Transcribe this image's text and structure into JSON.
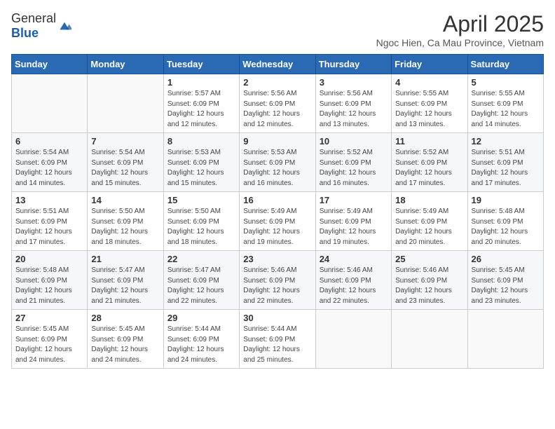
{
  "header": {
    "logo_general": "General",
    "logo_blue": "Blue",
    "month_title": "April 2025",
    "location": "Ngoc Hien, Ca Mau Province, Vietnam"
  },
  "weekdays": [
    "Sunday",
    "Monday",
    "Tuesday",
    "Wednesday",
    "Thursday",
    "Friday",
    "Saturday"
  ],
  "weeks": [
    [
      {
        "day": "",
        "info": ""
      },
      {
        "day": "",
        "info": ""
      },
      {
        "day": "1",
        "info": "Sunrise: 5:57 AM\nSunset: 6:09 PM\nDaylight: 12 hours and 12 minutes."
      },
      {
        "day": "2",
        "info": "Sunrise: 5:56 AM\nSunset: 6:09 PM\nDaylight: 12 hours and 12 minutes."
      },
      {
        "day": "3",
        "info": "Sunrise: 5:56 AM\nSunset: 6:09 PM\nDaylight: 12 hours and 13 minutes."
      },
      {
        "day": "4",
        "info": "Sunrise: 5:55 AM\nSunset: 6:09 PM\nDaylight: 12 hours and 13 minutes."
      },
      {
        "day": "5",
        "info": "Sunrise: 5:55 AM\nSunset: 6:09 PM\nDaylight: 12 hours and 14 minutes."
      }
    ],
    [
      {
        "day": "6",
        "info": "Sunrise: 5:54 AM\nSunset: 6:09 PM\nDaylight: 12 hours and 14 minutes."
      },
      {
        "day": "7",
        "info": "Sunrise: 5:54 AM\nSunset: 6:09 PM\nDaylight: 12 hours and 15 minutes."
      },
      {
        "day": "8",
        "info": "Sunrise: 5:53 AM\nSunset: 6:09 PM\nDaylight: 12 hours and 15 minutes."
      },
      {
        "day": "9",
        "info": "Sunrise: 5:53 AM\nSunset: 6:09 PM\nDaylight: 12 hours and 16 minutes."
      },
      {
        "day": "10",
        "info": "Sunrise: 5:52 AM\nSunset: 6:09 PM\nDaylight: 12 hours and 16 minutes."
      },
      {
        "day": "11",
        "info": "Sunrise: 5:52 AM\nSunset: 6:09 PM\nDaylight: 12 hours and 17 minutes."
      },
      {
        "day": "12",
        "info": "Sunrise: 5:51 AM\nSunset: 6:09 PM\nDaylight: 12 hours and 17 minutes."
      }
    ],
    [
      {
        "day": "13",
        "info": "Sunrise: 5:51 AM\nSunset: 6:09 PM\nDaylight: 12 hours and 17 minutes."
      },
      {
        "day": "14",
        "info": "Sunrise: 5:50 AM\nSunset: 6:09 PM\nDaylight: 12 hours and 18 minutes."
      },
      {
        "day": "15",
        "info": "Sunrise: 5:50 AM\nSunset: 6:09 PM\nDaylight: 12 hours and 18 minutes."
      },
      {
        "day": "16",
        "info": "Sunrise: 5:49 AM\nSunset: 6:09 PM\nDaylight: 12 hours and 19 minutes."
      },
      {
        "day": "17",
        "info": "Sunrise: 5:49 AM\nSunset: 6:09 PM\nDaylight: 12 hours and 19 minutes."
      },
      {
        "day": "18",
        "info": "Sunrise: 5:49 AM\nSunset: 6:09 PM\nDaylight: 12 hours and 20 minutes."
      },
      {
        "day": "19",
        "info": "Sunrise: 5:48 AM\nSunset: 6:09 PM\nDaylight: 12 hours and 20 minutes."
      }
    ],
    [
      {
        "day": "20",
        "info": "Sunrise: 5:48 AM\nSunset: 6:09 PM\nDaylight: 12 hours and 21 minutes."
      },
      {
        "day": "21",
        "info": "Sunrise: 5:47 AM\nSunset: 6:09 PM\nDaylight: 12 hours and 21 minutes."
      },
      {
        "day": "22",
        "info": "Sunrise: 5:47 AM\nSunset: 6:09 PM\nDaylight: 12 hours and 22 minutes."
      },
      {
        "day": "23",
        "info": "Sunrise: 5:46 AM\nSunset: 6:09 PM\nDaylight: 12 hours and 22 minutes."
      },
      {
        "day": "24",
        "info": "Sunrise: 5:46 AM\nSunset: 6:09 PM\nDaylight: 12 hours and 22 minutes."
      },
      {
        "day": "25",
        "info": "Sunrise: 5:46 AM\nSunset: 6:09 PM\nDaylight: 12 hours and 23 minutes."
      },
      {
        "day": "26",
        "info": "Sunrise: 5:45 AM\nSunset: 6:09 PM\nDaylight: 12 hours and 23 minutes."
      }
    ],
    [
      {
        "day": "27",
        "info": "Sunrise: 5:45 AM\nSunset: 6:09 PM\nDaylight: 12 hours and 24 minutes."
      },
      {
        "day": "28",
        "info": "Sunrise: 5:45 AM\nSunset: 6:09 PM\nDaylight: 12 hours and 24 minutes."
      },
      {
        "day": "29",
        "info": "Sunrise: 5:44 AM\nSunset: 6:09 PM\nDaylight: 12 hours and 24 minutes."
      },
      {
        "day": "30",
        "info": "Sunrise: 5:44 AM\nSunset: 6:09 PM\nDaylight: 12 hours and 25 minutes."
      },
      {
        "day": "",
        "info": ""
      },
      {
        "day": "",
        "info": ""
      },
      {
        "day": "",
        "info": ""
      }
    ]
  ]
}
